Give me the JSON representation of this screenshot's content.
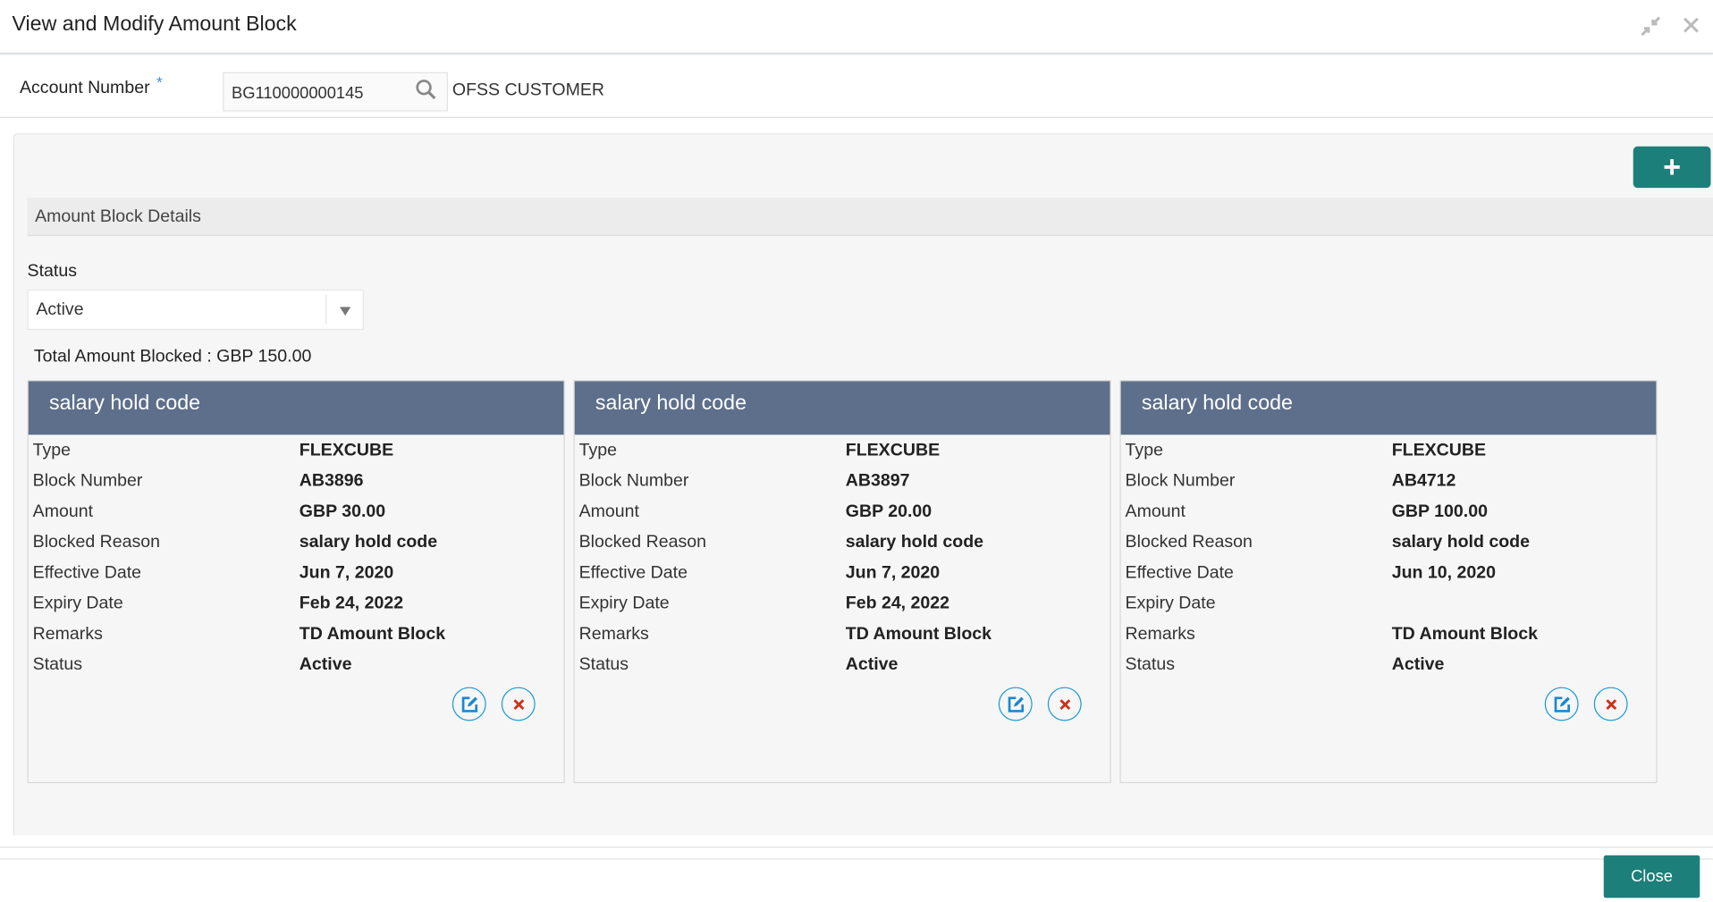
{
  "header": {
    "title": "View and Modify Amount Block",
    "minimize_icon": "collapse-arrows-icon",
    "close_icon": "close-icon"
  },
  "account": {
    "label": "Account Number",
    "required_mark": "*",
    "value": "BG110000000145",
    "customer_name": "OFSS CUSTOMER"
  },
  "section": {
    "title": "Amount Block Details",
    "add_icon": "plus-icon"
  },
  "filter": {
    "status_label": "Status",
    "status_value": "Active"
  },
  "total": "Total Amount Blocked : GBP 150.00",
  "labels": {
    "type": "Type",
    "block_number": "Block Number",
    "amount": "Amount",
    "blocked_reason": "Blocked Reason",
    "effective_date": "Effective Date",
    "expiry_date": "Expiry Date",
    "remarks": "Remarks",
    "status": "Status"
  },
  "cards": [
    {
      "title": "salary hold code",
      "type": "FLEXCUBE",
      "block_number": "AB3896",
      "amount": "GBP 30.00",
      "blocked_reason": "salary hold code",
      "effective_date": "Jun 7, 2020",
      "expiry_date": "Feb 24, 2022",
      "remarks": "TD Amount Block",
      "status": "Active"
    },
    {
      "title": "salary hold code",
      "type": "FLEXCUBE",
      "block_number": "AB3897",
      "amount": "GBP 20.00",
      "blocked_reason": "salary hold code",
      "effective_date": "Jun 7, 2020",
      "expiry_date": "Feb 24, 2022",
      "remarks": "TD Amount Block",
      "status": "Active"
    },
    {
      "title": "salary hold code",
      "type": "FLEXCUBE",
      "block_number": "AB4712",
      "amount": "GBP 100.00",
      "blocked_reason": "salary hold code",
      "effective_date": "Jun 10, 2020",
      "expiry_date": "",
      "remarks": "TD Amount Block",
      "status": "Active"
    }
  ],
  "footer": {
    "close_label": "Close"
  },
  "colors": {
    "accent": "#1d7f79",
    "card_header": "#5d6f8a",
    "icon_border": "#1a9ad6",
    "delete": "#d0301a"
  }
}
